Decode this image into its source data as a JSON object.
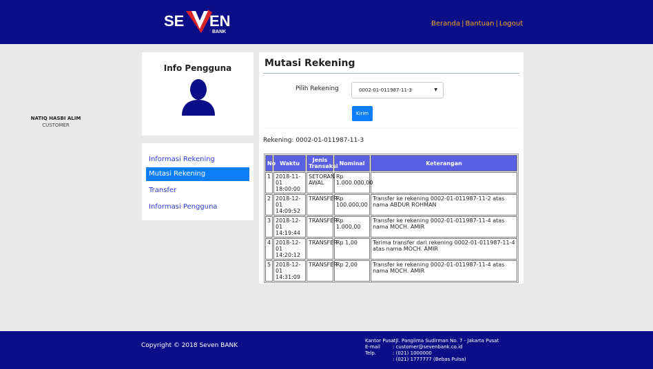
{
  "header": {
    "logo_text": "SEVEN BANK",
    "nav": {
      "home": "Beranda",
      "help": "Bantuan",
      "logout": "Logout",
      "separator": "|"
    }
  },
  "sidebar": {
    "info_title": "Info Pengguna",
    "user_name": "NATIQ HASBI ALIM",
    "user_role": "CUSTOMER",
    "menu": [
      {
        "label": "Informasi Rekening",
        "active": false
      },
      {
        "label": "Mutasi Rekening",
        "active": true
      },
      {
        "label": "Transfer",
        "active": false
      },
      {
        "label": "Informasi Pengguna",
        "active": false
      }
    ]
  },
  "main": {
    "title": "Mutasi Rekening",
    "pick_label": "Pilih Rekening",
    "selected_account": "0002-01-011987-11-3",
    "submit_label": "Kirim",
    "account_line": "Rekening: 0002-01-011987-11-3",
    "table": {
      "headers": [
        "No",
        "Waktu",
        "Jenis Transaksi",
        "Nominal",
        "Keterangan"
      ],
      "rows": [
        [
          "1",
          "2018-11-01 18:00:00",
          "SETORAN AWAL",
          "Rp 1.000.000,00",
          ""
        ],
        [
          "2",
          "2018-12-01 14:09:52",
          "TRANSFER",
          "Rp 100.000,00",
          "Transfer ke rekening 0002-01-011987-11-2 atas nama ABDUR ROHMAN"
        ],
        [
          "3",
          "2018-12-01 14:19:44",
          "TRANSFER",
          "Rp 1.000,00",
          "Transfer ke rekening 0002-01-011987-11-4 atas nama MOCH. AMIR"
        ],
        [
          "4",
          "2018-12-01 14:20:12",
          "TRANSFER",
          "Rp 1,00",
          "Terima transfer dari rekening 0002-01-011987-11-4 atas nama MOCH. AMIR"
        ],
        [
          "5",
          "2018-12-01 14:31:09",
          "TRANSFER",
          "Rp 2,00",
          "Transfer ke rekening 0002-01-011987-11-4 atas nama MOCH. AMIR"
        ]
      ]
    }
  },
  "footer": {
    "copyright": "Copyright © 2018 Seven BANK",
    "contact": [
      {
        "label": "Kantor Pusat",
        "value": ": Jl. Panglima Sudirman No. 7 - Jakarta Pusat"
      },
      {
        "label": "E-mail",
        "value": ": customer@sevenbank.co.id"
      },
      {
        "label": "Telp.",
        "value": ": (021) 1000000"
      },
      {
        "label": "",
        "value": ": (021) 1777777 (Bebas Pulsa)"
      }
    ]
  },
  "colors": {
    "brand_navy": "#0b0e86",
    "nav_orange": "#f3a21f",
    "accent_blue": "#0b7df7",
    "table_header": "#5b5fe4",
    "logo_red": "#d9232a"
  }
}
